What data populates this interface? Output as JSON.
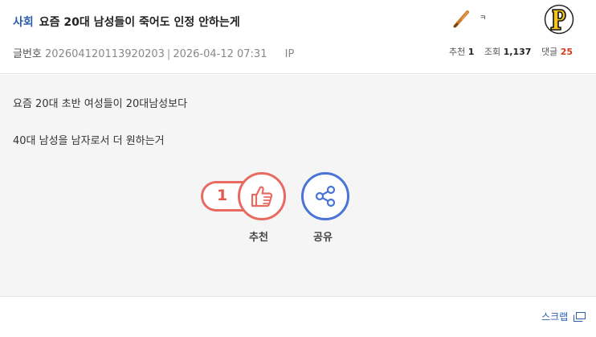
{
  "post": {
    "category": "사회",
    "title": "요즘 20대 남성들이 죽어도 인정 안하는게",
    "author_name": "ㅋ",
    "post_no_label": "글번호",
    "post_no": "20260412011392020​3",
    "datetime": "2026-04-12 07:31",
    "ip_label": "IP"
  },
  "stats": {
    "recommend_label": "추천",
    "recommend_count": "1",
    "views_label": "조회",
    "views_count": "1,137",
    "comments_label": "댓글",
    "comments_count": "25"
  },
  "content": {
    "line1": "요즘 20대 초반 여성들이 20대남성보다",
    "line2": "40대 남성을 남자로서 더 원하는거"
  },
  "actions": {
    "recommend_count": "1",
    "recommend_label": "추천",
    "share_label": "공유",
    "scrap_label": "스크랩"
  },
  "colors": {
    "category": "#2a5cb0",
    "recommend": "#e86b62",
    "share": "#4a74d6",
    "comments": "#d63a1f",
    "pirates_yellow": "#f6c51d"
  },
  "icons": {
    "author_badge": "baseball-bat-icon",
    "team_logo": "pirates-p-logo",
    "recommend": "thumbs-up-icon",
    "share": "share-icon",
    "scrap": "window-icon"
  }
}
